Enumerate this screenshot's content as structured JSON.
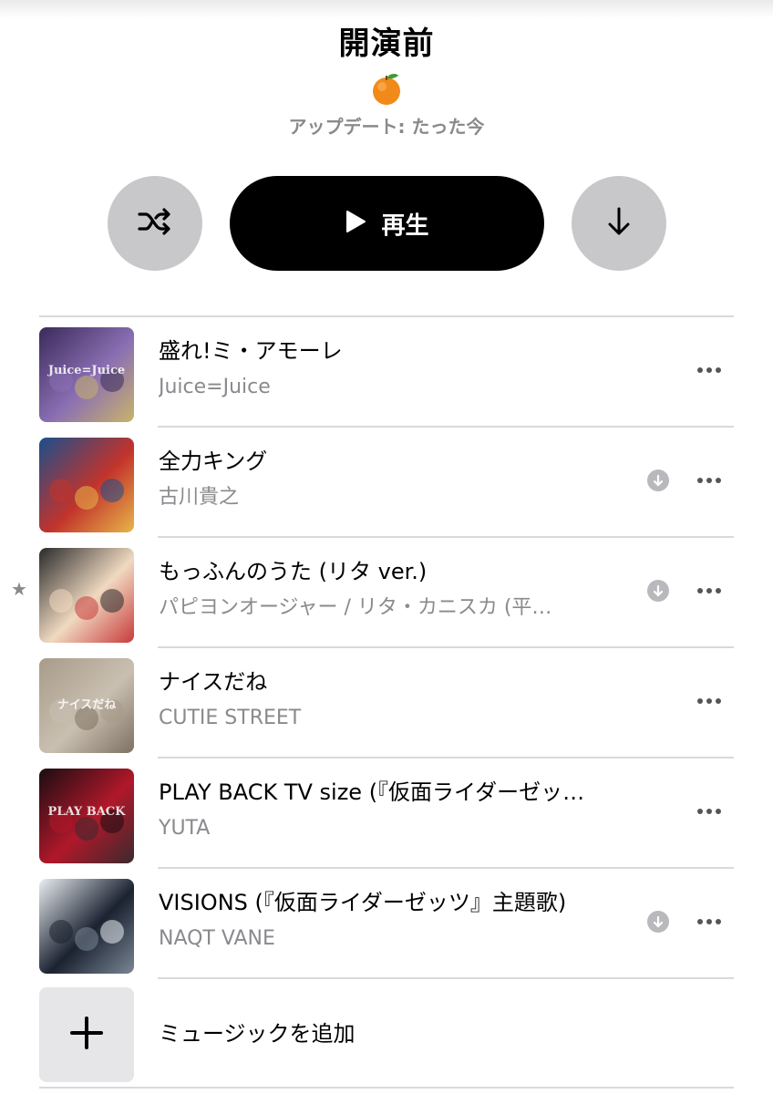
{
  "playlist": {
    "title": "開演前",
    "emoji": "tangerine-emoji",
    "updated": "アップデート: たった今"
  },
  "controls": {
    "shuffle_icon": "shuffle-icon",
    "play_label": "再生",
    "download_icon": "download-icon"
  },
  "tracks": [
    {
      "title": "盛れ!ミ・アモーレ",
      "artist": "Juice=Juice",
      "downloaded": false,
      "starred": false,
      "art_colors": [
        "#3b2a5a",
        "#8a6fb3",
        "#c9b36a"
      ],
      "art_text": "Juice=Juice"
    },
    {
      "title": "全力キング",
      "artist": "古川貴之",
      "downloaded": true,
      "starred": false,
      "art_colors": [
        "#1b4f8c",
        "#c2332b",
        "#e8b64a"
      ],
      "art_text": ""
    },
    {
      "title": "もっふんのうた (リタ ver.)",
      "artist": "パピヨンオージャー / リタ・カニスカ (平…",
      "downloaded": true,
      "starred": true,
      "art_colors": [
        "#2a2a2a",
        "#f0d9c0",
        "#c83a3a"
      ],
      "art_text": ""
    },
    {
      "title": "ナイスだね",
      "artist": "CUTIE STREET",
      "downloaded": false,
      "starred": false,
      "art_colors": [
        "#a89b8a",
        "#c9bfb0",
        "#7d7163"
      ],
      "art_text": "ナイスだね"
    },
    {
      "title": "PLAY BACK TV size (『仮面ライダーゼッ…",
      "artist": "YUTA",
      "downloaded": false,
      "starred": false,
      "art_colors": [
        "#1a0d12",
        "#b0182a",
        "#3a2a2e"
      ],
      "art_text": "PLAY BACK"
    },
    {
      "title": "VISIONS (『仮面ライダーゼッツ』主題歌)",
      "artist": "NAQT VANE",
      "downloaded": true,
      "starred": false,
      "art_colors": [
        "#e9eef2",
        "#1b2230",
        "#7a8796"
      ],
      "art_text": ""
    }
  ],
  "add_music": {
    "label": "ミュージックを追加",
    "icon": "plus-icon"
  }
}
